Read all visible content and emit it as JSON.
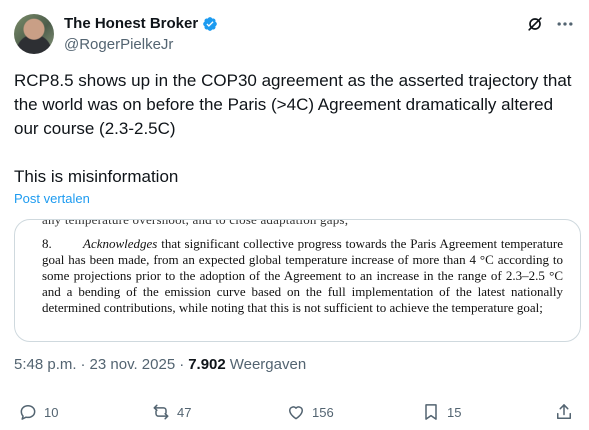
{
  "author": {
    "display_name": "The Honest Broker",
    "handle": "@RogerPielkeJr"
  },
  "tweet": {
    "paragraphs": [
      "RCP8.5 shows up in the COP30 agreement as the asserted trajectory that the world was on before the Paris (>4C) Agreement dramatically altered our course (2.3-2.5C)",
      "This is misinformation"
    ],
    "translate_label": "Post vertalen"
  },
  "quote_image": {
    "cut_off_line": "any temperature overshoot, and to close adaptation gaps;",
    "paragraph_number": "8.",
    "emphasis_word": "Acknowledges",
    "text": " that significant collective progress towards the Paris Agreement temperature goal has been made, from an expected global temperature increase of more than 4 °C according to some projections prior to the adoption of the Agreement to an increase in the range of 2.3–2.5 °C and a bending of the emission curve based on the full implementation of the latest nationally determined contributions, while noting that this is not sufficient to achieve the temperature goal;"
  },
  "meta": {
    "time": "5:48 p.m.",
    "separator": "·",
    "date": "23 nov. 2025",
    "views_count": "7.902",
    "views_label": "Weergaven"
  },
  "actions": {
    "replies": "10",
    "reposts": "47",
    "likes": "156",
    "bookmarks": "15"
  },
  "colors": {
    "accent": "#1d9bf0",
    "muted": "#536471",
    "border": "#cfd9de"
  }
}
